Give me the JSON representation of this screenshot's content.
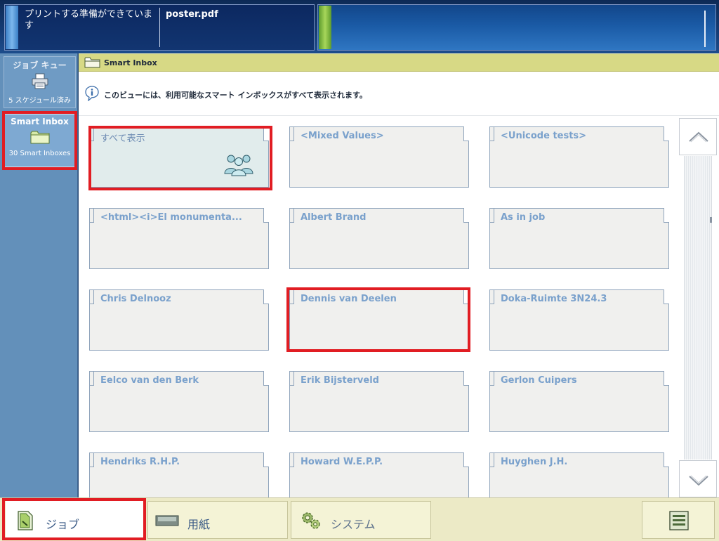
{
  "status": {
    "message": "プリントする準備ができています",
    "file_name": "poster.pdf"
  },
  "sidebar": {
    "job_queue": {
      "title": "ジョブ キュー",
      "subtitle": "5 スケジュール済み",
      "icon": "printer-icon"
    },
    "smart_inbox": {
      "title": "Smart Inbox",
      "subtitle": "30 Smart Inboxes",
      "icon": "folder-icon",
      "selected": true
    }
  },
  "breadcrumb": {
    "label": "Smart Inbox",
    "icon": "folder-icon"
  },
  "info": {
    "text": "このビューには、利用可能なスマート インボックスがすべて表示されます。",
    "icon": "info-icon"
  },
  "inboxes": [
    {
      "label": "すべて表示",
      "selected": true,
      "icon": "users-icon"
    },
    {
      "label": "<Mixed Values>"
    },
    {
      "label": "<Unicode tests>"
    },
    {
      "label": "<html><i>El monumenta..."
    },
    {
      "label": "Albert Brand"
    },
    {
      "label": "As in job"
    },
    {
      "label": "Chris Delnooz"
    },
    {
      "label": "Dennis van Deelen"
    },
    {
      "label": "Doka-Ruimte 3N24.3"
    },
    {
      "label": "Eelco van den Berk"
    },
    {
      "label": "Erik Bijsterveld"
    },
    {
      "label": "Gerlon Cuipers"
    },
    {
      "label": "Hendriks R.H.P."
    },
    {
      "label": "Howard W.E.P.P."
    },
    {
      "label": "Huyghen J.H."
    }
  ],
  "tabs": {
    "job": "ジョブ",
    "paper": "用紙",
    "system": "システム"
  },
  "colors": {
    "accent_highlight": "#e11d23",
    "breadcrumb_bg": "#d7d985",
    "sidebar_bg": "#6390ba",
    "card_label": "#7aa1cc"
  }
}
